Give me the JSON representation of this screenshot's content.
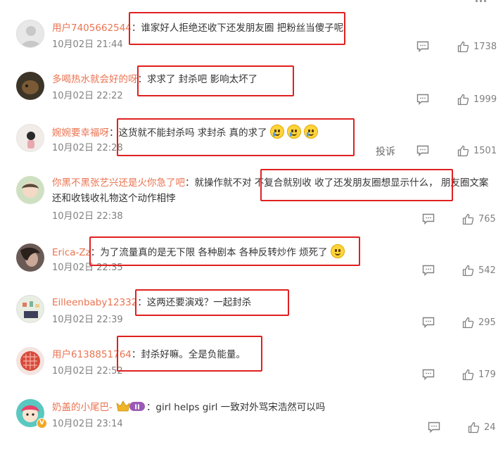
{
  "comments": [
    {
      "user": "用户7405662544",
      "text": "谁家好人拒绝还收下还发朋友圈 把粉丝当傻子呢",
      "date": "10月02日 21:44",
      "likes": "1738",
      "avatar_color": "#e6e6e6"
    },
    {
      "user": "多喝热水就会好的呀",
      "text": "求求了 封杀吧 影响太坏了",
      "date": "10月02日 22:22",
      "likes": "1999",
      "avatar_color": "#4a3a2a"
    },
    {
      "user": "婉婉要幸福呀",
      "text": "这货就不能封杀吗 求封杀 真的求了",
      "date": "10月02日 22:28",
      "likes": "1501",
      "avatar_color": "#f2ece8",
      "report": "投诉"
    },
    {
      "user": "你黑不黑张艺兴还是火你急了吧",
      "text": "就操作就不对 不复合就别收 收了还发朋友圈想显示什么， 朋友圈文案",
      "text2": "还和收钱收礼物这个动作相悖",
      "date": "10月02日 22:38",
      "likes": "765",
      "avatar_color": "#c8d8b8"
    },
    {
      "user": "Erica-Zz",
      "text": "为了流量真的是无下限 各种剧本 各种反转炒作 烦死了",
      "date": "10月02日 22:35",
      "likes": "542",
      "avatar_color": "#6a5a55"
    },
    {
      "user": "Eilleenbaby12332",
      "text": "这两还要演戏？一起封杀",
      "date": "10月02日 22:39",
      "likes": "295",
      "avatar_color": "#d8e8d0"
    },
    {
      "user": "用户6138851764",
      "text": "封杀好嘛。全是负能量。",
      "date": "10月02日 22:52",
      "likes": "179",
      "avatar_color": "#d84a3a"
    },
    {
      "user": "奶盖的小尾巴-",
      "text": "girl helps girl 一致对外骂宋浩然可以吗",
      "date": "10月02日 23:14",
      "likes": "24",
      "avatar_color": "#58c8c0",
      "badge": "II"
    }
  ],
  "colors": {
    "username": "#eb7350",
    "highlight_box": "#e02020",
    "meta": "#808080"
  },
  "icons": {
    "reply": "comment-icon",
    "like": "thumbs-up-icon",
    "verified": "v-badge-icon"
  },
  "separator": "："
}
